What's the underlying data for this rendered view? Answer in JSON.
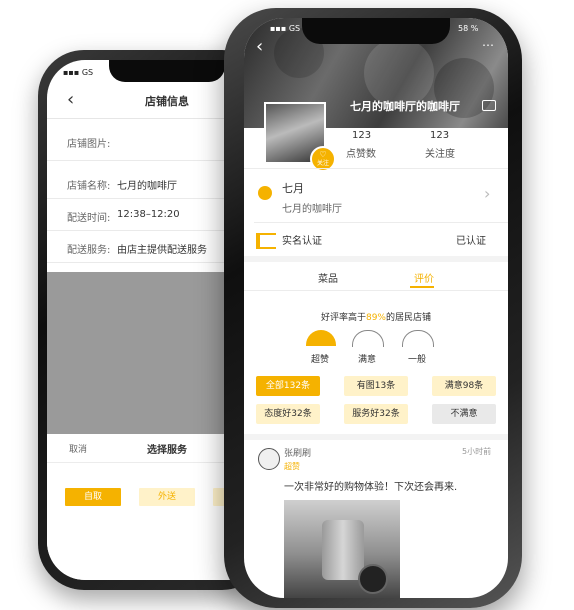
{
  "back": {
    "status_carrier": "GS",
    "nav_title": "店铺信息",
    "rows": [
      {
        "label": "店铺图片:",
        "value": ""
      },
      {
        "label": "店铺名称:",
        "value": "七月的咖啡厅"
      },
      {
        "label": "配送时间:",
        "value": "12:38–12:20"
      },
      {
        "label": "配送服务:",
        "value": "由店主提供配送服务"
      }
    ],
    "sheet": {
      "cancel": "取消",
      "title": "选择服务",
      "option_pickup": "自取",
      "option_delivery": "外送"
    }
  },
  "front": {
    "status": {
      "carrier": "GS",
      "battery": "58 %"
    },
    "shop_name": "七月的咖啡厅的咖啡厅",
    "follow_label": "关注",
    "stats": [
      {
        "value": "123",
        "label": "点赞数"
      },
      {
        "value": "123",
        "label": "关注度"
      }
    ],
    "owner": {
      "name": "七月",
      "shop": "七月的咖啡厅"
    },
    "verify": {
      "label": "实名认证",
      "status": "已认证"
    },
    "tabs": [
      {
        "label": "菜品",
        "active": false
      },
      {
        "label": "评价",
        "active": true
      }
    ],
    "rating": {
      "prefix": "好评率高于",
      "percent": "89%",
      "suffix": "的居民店铺"
    },
    "faces": [
      {
        "label": "超赞"
      },
      {
        "label": "满意"
      },
      {
        "label": "一般"
      }
    ],
    "filters": [
      {
        "label": "全部132条",
        "active": true
      },
      {
        "label": "有图13条",
        "active": false
      },
      {
        "label": "满意98条",
        "active": false
      },
      {
        "label": "态度好32条",
        "active": false
      },
      {
        "label": "服务好32条",
        "active": false
      },
      {
        "label": "不满意",
        "active": false,
        "gray": true
      }
    ],
    "review": {
      "user": "张刷刷",
      "badge": "超赞",
      "time": "5小时前",
      "text": "一次非常好的购物体验！下次还会再来."
    },
    "colors": {
      "accent": "#f5b200",
      "accent_light": "#fff2c9"
    }
  }
}
